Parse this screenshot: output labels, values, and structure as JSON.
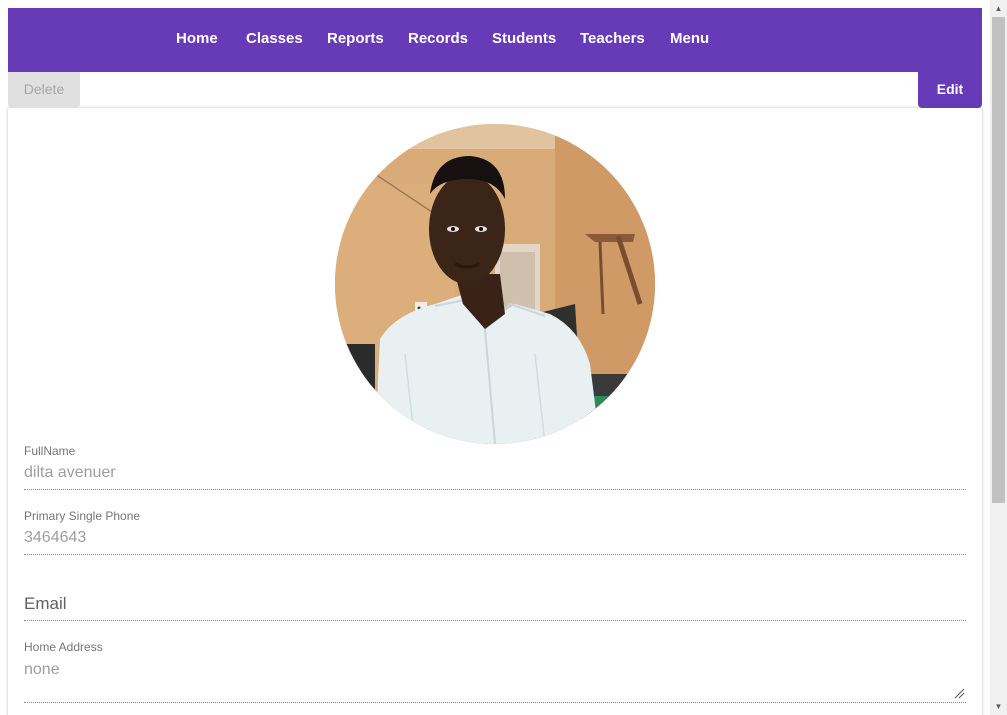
{
  "nav": {
    "items": [
      {
        "label": "Home"
      },
      {
        "label": "Classes"
      },
      {
        "label": "Reports"
      },
      {
        "label": "Records"
      },
      {
        "label": "Students"
      },
      {
        "label": "Teachers"
      },
      {
        "label": "Menu"
      }
    ]
  },
  "actions": {
    "delete_label": "Delete",
    "edit_label": "Edit"
  },
  "profile": {
    "fullname": {
      "label": "FullName",
      "value": "dilta avenuer"
    },
    "phone": {
      "label": "Primary Single Phone",
      "value": "3464643"
    },
    "email": {
      "placeholder": "Email"
    },
    "address": {
      "label": "Home Address",
      "value": "none"
    }
  },
  "colors": {
    "primary": "#673ab7",
    "delete_bg": "#e0e0e0"
  },
  "icons": {
    "avatar": "profile-photo",
    "scroll_up": "arrow-up-icon",
    "scroll_down": "arrow-down-icon",
    "resize": "resize-grip-icon"
  }
}
